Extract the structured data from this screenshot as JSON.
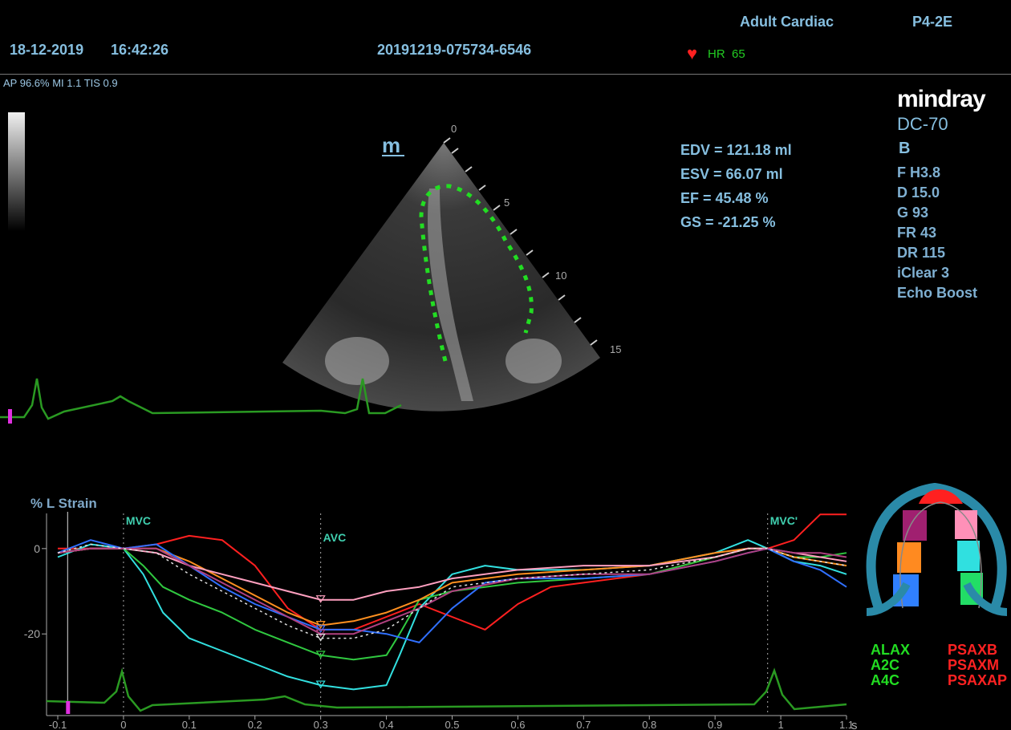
{
  "header": {
    "date": "18-12-2019",
    "time": "16:42:26",
    "study_id": "20191219-075734-6546",
    "preset": "Adult Cardiac",
    "probe": "P4-2E",
    "hr_label": "HR",
    "hr_value": "65",
    "acoustic": "AP 96.6%  MI 1.1  TIS 0.9"
  },
  "brand": {
    "name": "mindray",
    "model": "DC-70",
    "mode": "B"
  },
  "image_params": [
    "F H3.8",
    "D 15.0",
    "G 93",
    "FR 43",
    "DR 115",
    "iClear 3",
    "Echo Boost"
  ],
  "measurements": [
    "EDV = 121.18 ml",
    "ESV = 66.07 ml",
    "EF  = 45.48 %",
    "GS = -21.25 %"
  ],
  "depth_labels": [
    "0",
    "5",
    "10",
    "15"
  ],
  "marker_m": "m",
  "legend": {
    "left": [
      "ALAX",
      "A2C",
      "A4C"
    ],
    "right": [
      "PSAXB",
      "PSAXM",
      "PSAXAP"
    ]
  },
  "chart_data": {
    "type": "line",
    "ylabel": "% L Strain",
    "xlabel": "s",
    "xlim": [
      -0.1,
      1.1
    ],
    "ylim": [
      -38,
      12
    ],
    "x_ticks": [
      -0.1,
      0,
      0.1,
      0.2,
      0.3,
      0.4,
      0.5,
      0.6,
      0.7,
      0.8,
      0.9,
      1,
      1.1
    ],
    "x_tick_labels": [
      "-0.1",
      "0",
      "0.1",
      "0.2",
      "0.3",
      "0.4",
      "0.5",
      "0.6",
      "0.7",
      "0.8",
      "0.9",
      "1",
      "1.1"
    ],
    "y_ticks": [
      0,
      -20
    ],
    "y_tick_labels": [
      "0",
      "-20"
    ],
    "events": [
      {
        "label": "MVC",
        "x": 0.0
      },
      {
        "label": "AVC",
        "x": 0.3
      },
      {
        "label": "MVC'",
        "x": 0.98
      }
    ],
    "series": [
      {
        "color": "#ff2020",
        "x": [
          -0.1,
          -0.05,
          0,
          0.05,
          0.1,
          0.15,
          0.2,
          0.25,
          0.3,
          0.35,
          0.4,
          0.45,
          0.5,
          0.55,
          0.6,
          0.65,
          0.7,
          0.8,
          0.9,
          0.95,
          0.98,
          1.02,
          1.06,
          1.1
        ],
        "y": [
          0,
          0,
          0,
          1,
          3,
          2,
          -4,
          -14,
          -19,
          -19,
          -16,
          -13,
          -16,
          -19,
          -13,
          -9,
          -8,
          -6,
          -2,
          0,
          0,
          2,
          8,
          8
        ]
      },
      {
        "color": "#32e0e0",
        "x": [
          -0.1,
          -0.05,
          0,
          0.03,
          0.06,
          0.1,
          0.15,
          0.2,
          0.25,
          0.3,
          0.35,
          0.4,
          0.42,
          0.45,
          0.5,
          0.55,
          0.6,
          0.7,
          0.8,
          0.9,
          0.95,
          0.98,
          1.02,
          1.06,
          1.1
        ],
        "y": [
          -2,
          1,
          0,
          -6,
          -15,
          -21,
          -24,
          -27,
          -30,
          -32,
          -33,
          -32,
          -25,
          -14,
          -6,
          -4,
          -5,
          -5,
          -4,
          -1,
          2,
          0,
          -3,
          -4,
          -6
        ]
      },
      {
        "color": "#30c840",
        "x": [
          -0.1,
          -0.05,
          0,
          0.03,
          0.06,
          0.1,
          0.15,
          0.2,
          0.25,
          0.3,
          0.35,
          0.4,
          0.42,
          0.45,
          0.5,
          0.55,
          0.6,
          0.7,
          0.8,
          0.9,
          0.95,
          0.98,
          1.02,
          1.06,
          1.1
        ],
        "y": [
          -1,
          0,
          0,
          -4,
          -9,
          -12,
          -15,
          -19,
          -22,
          -25,
          -26,
          -25,
          -20,
          -12,
          -10,
          -9,
          -8,
          -7,
          -6,
          -2,
          0,
          0,
          -2,
          -2,
          -1
        ]
      },
      {
        "color": "#ff9020",
        "x": [
          -0.1,
          -0.05,
          0,
          0.05,
          0.1,
          0.15,
          0.2,
          0.25,
          0.3,
          0.35,
          0.4,
          0.45,
          0.5,
          0.6,
          0.7,
          0.8,
          0.9,
          0.95,
          0.98,
          1.02,
          1.06,
          1.1
        ],
        "y": [
          -1,
          0,
          0,
          0,
          -3,
          -7,
          -11,
          -15,
          -18,
          -17,
          -15,
          -12,
          -8,
          -6,
          -5,
          -4,
          -1,
          0,
          0,
          -2,
          -3,
          -4
        ]
      },
      {
        "color": "#ffa0c0",
        "x": [
          -0.1,
          -0.05,
          0,
          0.05,
          0.1,
          0.15,
          0.2,
          0.25,
          0.3,
          0.35,
          0.4,
          0.45,
          0.5,
          0.6,
          0.7,
          0.8,
          0.9,
          0.95,
          0.98,
          1.02,
          1.06,
          1.1
        ],
        "y": [
          -1,
          0,
          0,
          -1,
          -4,
          -6,
          -8,
          -10,
          -12,
          -12,
          -10,
          -9,
          -7,
          -5,
          -4,
          -4,
          -2,
          0,
          0,
          -1,
          -2,
          -3
        ]
      },
      {
        "color": "#3070ff",
        "x": [
          -0.1,
          -0.05,
          0,
          0.05,
          0.1,
          0.15,
          0.2,
          0.25,
          0.3,
          0.35,
          0.4,
          0.45,
          0.5,
          0.55,
          0.6,
          0.7,
          0.8,
          0.9,
          0.95,
          0.98,
          1.02,
          1.06,
          1.1
        ],
        "y": [
          -1,
          2,
          0,
          1,
          -4,
          -9,
          -13,
          -16,
          -19,
          -19,
          -20,
          -22,
          -14,
          -8,
          -7,
          -7,
          -6,
          -3,
          -1,
          0,
          -3,
          -5,
          -9
        ]
      },
      {
        "color": "#b04080",
        "x": [
          -0.1,
          -0.05,
          0,
          0.05,
          0.1,
          0.15,
          0.2,
          0.25,
          0.3,
          0.35,
          0.4,
          0.45,
          0.5,
          0.6,
          0.7,
          0.8,
          0.9,
          0.95,
          0.98,
          1.02,
          1.06,
          1.1
        ],
        "y": [
          -1,
          0,
          0,
          0,
          -4,
          -8,
          -12,
          -16,
          -20,
          -20,
          -17,
          -14,
          -10,
          -7,
          -6,
          -6,
          -3,
          -1,
          0,
          -1,
          -1,
          -2
        ]
      },
      {
        "color": "#e0e0e0",
        "dotted": true,
        "x": [
          -0.1,
          -0.05,
          0,
          0.05,
          0.1,
          0.15,
          0.2,
          0.25,
          0.3,
          0.35,
          0.4,
          0.45,
          0.5,
          0.6,
          0.7,
          0.8,
          0.9,
          0.95,
          0.98,
          1.02,
          1.06,
          1.1
        ],
        "y": [
          -1,
          1,
          0,
          -1,
          -6,
          -10,
          -14,
          -18,
          -21,
          -21,
          -19,
          -14,
          -9,
          -7,
          -6,
          -5,
          -2,
          0,
          0,
          -2,
          -3,
          -4
        ]
      }
    ]
  }
}
